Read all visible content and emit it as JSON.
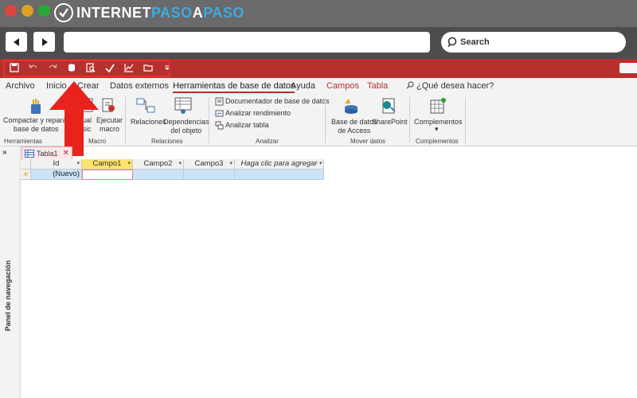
{
  "logo": {
    "part1": "INTERNET",
    "part2": "PASO",
    "part3": "A",
    "part4": "PASO"
  },
  "browser": {
    "back_icon": "arrow-left-icon",
    "forward_icon": "arrow-right-icon",
    "url": "",
    "search_label": "Search"
  },
  "qat": {
    "icons": [
      "save-icon",
      "undo-icon",
      "redo-icon",
      "database-tools-icon",
      "print-preview-icon",
      "spelling-icon",
      "chart-icon",
      "open-folder-icon",
      "customize-qat-icon"
    ],
    "highlight_color": "#e53030"
  },
  "tabs": {
    "archivo": "Archivo",
    "inicio": "Inicio",
    "crear": "Crear",
    "datos_externos": "Datos externos",
    "herramientas": "Herramientas de base de datos",
    "ayuda": "Ayuda",
    "campos": "Campos",
    "tabla": "Tabla",
    "tell_me": "¿Qué desea hacer?"
  },
  "ribbon": {
    "compactar_1": "Compactar y reparar",
    "compactar_2": "base de datos",
    "visual_1": "ual",
    "visual_2": "sic",
    "ejecutar_1": "Ejecutar",
    "ejecutar_2": "macro",
    "relaciones": "Relaciones",
    "dependencias_1": "Dependencias",
    "dependencias_2": "del objeto",
    "documentador": "Documentador de base de datos",
    "rendimiento": "Analizar rendimiento",
    "analizar_tabla": "Analizar tabla",
    "access_1": "Base de datos",
    "access_2": "de Access",
    "sharepoint": "SharePoint",
    "complementos": "Complementos",
    "groups": {
      "herramientas": "Herramientas",
      "macro": "Macro",
      "relaciones": "Relaciones",
      "analizar": "Analizar",
      "mover": "Mover datos",
      "complementos": "Complementos"
    }
  },
  "nav_pane": {
    "expand": "»",
    "label": "Panel de navegación"
  },
  "doc_tab": {
    "label": "Tabla1",
    "close": "✕"
  },
  "table": {
    "headers": [
      "Id",
      "Campo1",
      "Campo2",
      "Campo3",
      "Haga clic para agregar"
    ],
    "new_row_marker": "✳",
    "new_row_value": "(Nuevo)"
  },
  "colors": {
    "access_red": "#b7302d",
    "selected_field": "#fce46a",
    "new_row": "#cde4f7",
    "arrow": "#e8221d"
  }
}
